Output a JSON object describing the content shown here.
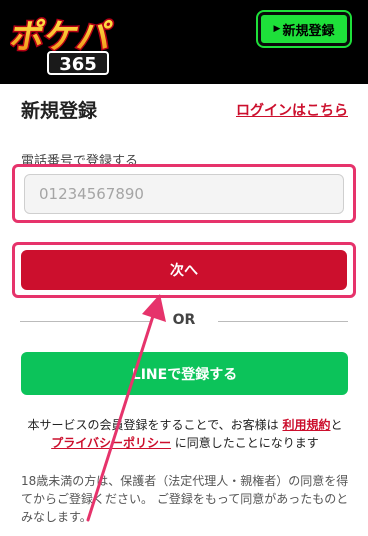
{
  "header": {
    "logo_text": "ポケパ",
    "logo_sub": "365",
    "register_button": "新規登録",
    "button_icon": "triangle-right-icon"
  },
  "form": {
    "title": "新規登録",
    "login_link": "ログインはこちら",
    "phone_label": "電話番号で登録する",
    "phone_placeholder": "01234567890",
    "next_button": "次へ",
    "or_text": "OR",
    "line_button": "LINEで登録する"
  },
  "terms": {
    "part1": "本サービスの会員登録をすることで、お客様は",
    "link1": "利用規約",
    "part2": "と",
    "link2": "プライバシーポリシー",
    "part3": "に同意したことになります"
  },
  "notice": "18歳未満の方は、保護者（法定代理人・親権者）の同意を得てからご登録ください。 ご登録をもって同意があったものとみなします。",
  "colors": {
    "brand_red": "#cc0f2d",
    "line_green": "#0cc35a",
    "highlight_pink": "#e6336b",
    "header_button_green": "#1ee03a"
  }
}
